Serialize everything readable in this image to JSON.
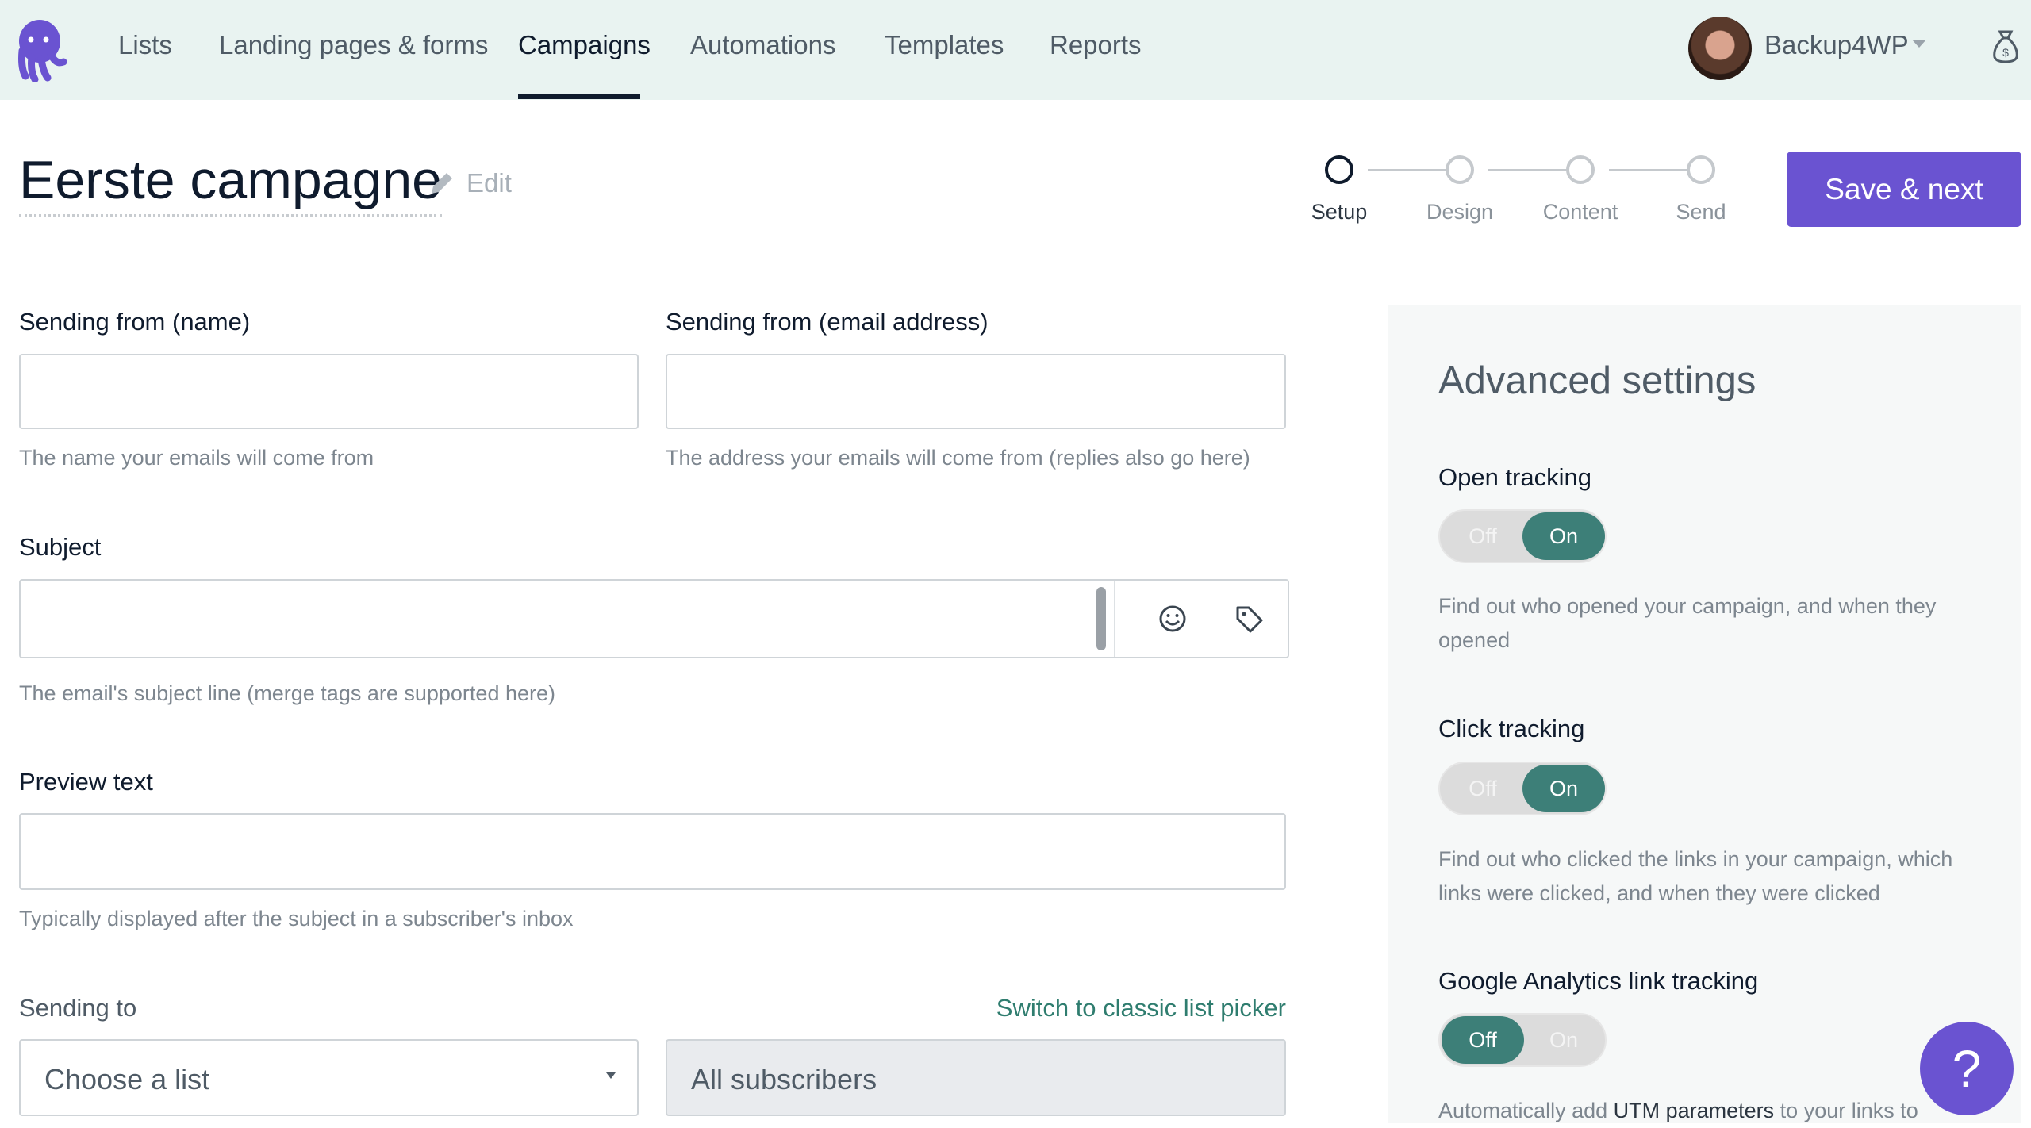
{
  "nav": {
    "items": [
      "Lists",
      "Landing pages & forms",
      "Campaigns",
      "Automations",
      "Templates",
      "Reports"
    ],
    "active": "Campaigns",
    "account": "Backup4WP"
  },
  "campaign": {
    "title": "Eerste campagne",
    "edit_label": "Edit"
  },
  "steps": [
    {
      "label": "Setup",
      "current": true
    },
    {
      "label": "Design"
    },
    {
      "label": "Content"
    },
    {
      "label": "Send"
    }
  ],
  "save_label": "Save & next",
  "form": {
    "from_name": {
      "label": "Sending from (name)",
      "value": "",
      "help": "The name your emails will come from"
    },
    "from_email": {
      "label": "Sending from (email address)",
      "value": "",
      "help": "The address your emails will come from (replies also go here)"
    },
    "subject": {
      "label": "Subject",
      "value": "",
      "help": "The email's subject line (merge tags are supported here)"
    },
    "preview": {
      "label": "Preview text",
      "value": "",
      "help": "Typically displayed after the subject in a subscriber's inbox"
    },
    "sending_to": {
      "label": "Sending to",
      "switch_link": "Switch to classic list picker",
      "select_value": "Choose a list",
      "segment": "All subscribers"
    }
  },
  "advanced": {
    "title": "Advanced settings",
    "off": "Off",
    "on": "On",
    "open": {
      "label": "Open tracking",
      "state": "On",
      "desc": "Find out who opened your campaign, and when they opened"
    },
    "click": {
      "label": "Click tracking",
      "state": "On",
      "desc": "Find out who clicked the links in your campaign, which links were clicked, and when they were clicked"
    },
    "ga": {
      "label": "Google Analytics link tracking",
      "state": "Off",
      "desc_pre": "Automatically add ",
      "desc_bold": "UTM parameters",
      "desc_post": " to your links to"
    }
  },
  "help_button": "?",
  "colors": {
    "accent": "#6a53d1",
    "toggle_on": "#3d7f78",
    "link": "#2f7d6f",
    "nav_bg": "#e9f3f1"
  }
}
